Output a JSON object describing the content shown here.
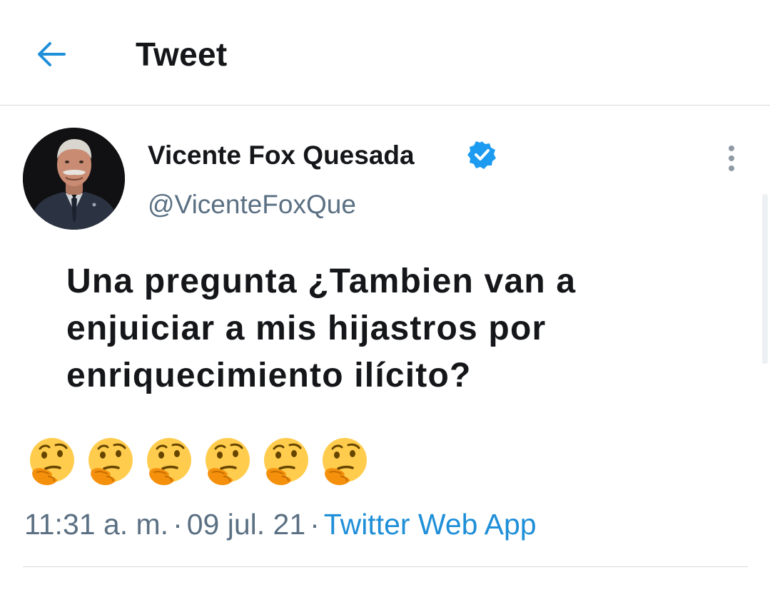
{
  "header": {
    "title": "Tweet",
    "back_icon": "back-arrow-icon"
  },
  "tweet": {
    "author_name": "Vicente Fox Quesada",
    "author_handle": "@VicenteFoxQue",
    "verified_icon": "verified-badge-icon",
    "more_icon": "more-options-icon",
    "text": "Una pregunta ¿Tambien van a enjuiciar a mis hijastros por enriquecimiento ilícito?",
    "emojis": [
      "thinking-face",
      "thinking-face",
      "thinking-face",
      "thinking-face",
      "thinking-face",
      "thinking-face"
    ],
    "time": "11:31 a. m.",
    "separator": "·",
    "date": "09 jul. 21",
    "source": "Twitter Web App"
  },
  "colors": {
    "accent": "#1d9bf0",
    "secondary_text": "#5b7083",
    "primary_text": "#141619",
    "emoji_yellow": "#ffcc4d"
  }
}
